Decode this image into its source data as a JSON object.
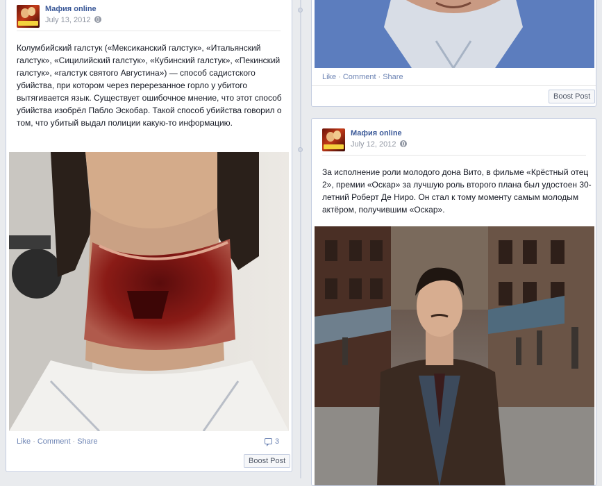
{
  "post_left": {
    "author": "Мафия online",
    "date": "July 13, 2012",
    "text": "Колумбийский галстук («Мексиканский галстук», «Итальянский галстук», «Сицилийский галстук», «Кубинский галстук», «Пекинский галстук», «галстук святого Августина») — способ садистского убийства, при котором через перерезанное горло у убитого вытягивается язык. Существует ошибочное мнение, что этот способ убийства изобрёл Пабло Эскобар. Такой способ убийства говорил о том, что убитый выдал полиции какую-то информацию.",
    "actions": {
      "like": "Like",
      "comment": "Comment",
      "share": "Share"
    },
    "comment_count": "3",
    "boost": "Boost Post"
  },
  "post_right_top": {
    "actions": {
      "like": "Like",
      "comment": "Comment",
      "share": "Share"
    },
    "boost": "Boost Post"
  },
  "post_right": {
    "author": "Мафия online",
    "date": "July 12, 2012",
    "text": "За исполнение роли молодого дона Вито, в фильме «Крёстный отец 2», премии «Оскар» за лучшую роль второго плана был удостоен 30-летний Роберт Де Ниро. Он стал к тому моменту самым молодым актёром, получившим «Оскар»."
  },
  "colors": {
    "link": "#3b5998",
    "muted": "#9197a3",
    "action": "#6d84b4",
    "background": "#e9ebee"
  }
}
